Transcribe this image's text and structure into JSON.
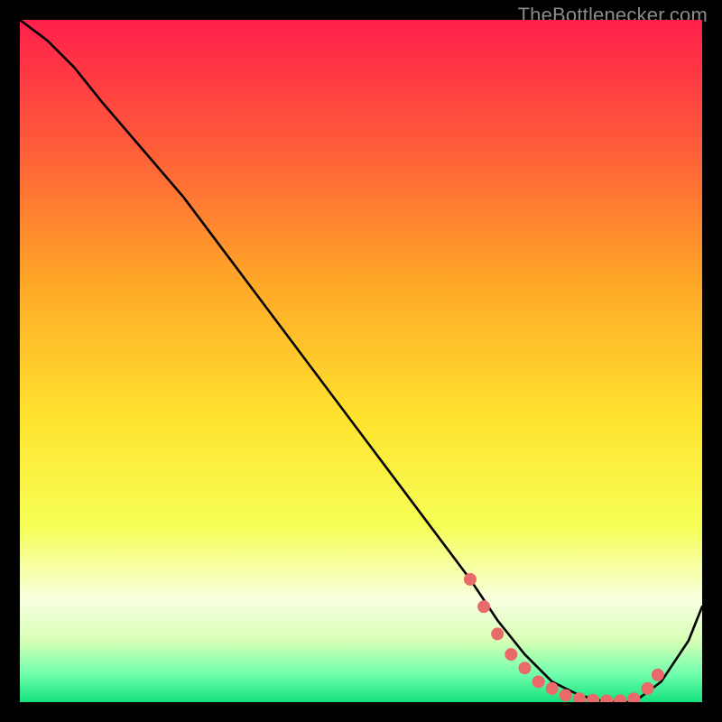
{
  "attribution": "TheBottlenecker.com",
  "colors": {
    "page_bg": "#000000",
    "gradient_top": "#ff1f4b",
    "gradient_upper": "#ff5a3a",
    "gradient_mid_high": "#ffa628",
    "gradient_mid": "#ffe22e",
    "gradient_mid_low": "#f6ff55",
    "gradient_low1": "#d6ffb5",
    "gradient_low2": "#6effad",
    "gradient_band_light": "#f8ffe0",
    "gradient_bottom": "#14e07c",
    "curve": "#000000",
    "marker_fill": "#e96a68",
    "marker_stroke": "#e96a68"
  },
  "chart_data": {
    "type": "line",
    "title": "",
    "xlabel": "",
    "ylabel": "",
    "xlim": [
      0,
      100
    ],
    "ylim": [
      0,
      100
    ],
    "series": [
      {
        "name": "bottleneck-curve",
        "x": [
          0,
          4,
          8,
          12,
          18,
          24,
          30,
          36,
          42,
          48,
          54,
          60,
          66,
          70,
          74,
          78,
          82,
          86,
          90,
          94,
          98,
          100
        ],
        "y": [
          100,
          97,
          93,
          88,
          81,
          74,
          66,
          58,
          50,
          42,
          34,
          26,
          18,
          12,
          7,
          3,
          1,
          0,
          0,
          3,
          9,
          14
        ]
      }
    ],
    "markers": {
      "name": "highlight-region",
      "x": [
        66,
        68,
        70,
        72,
        74,
        76,
        78,
        80,
        82,
        84,
        86,
        88,
        90,
        92,
        93.5
      ],
      "y": [
        18,
        14,
        10,
        7,
        5,
        3,
        2,
        1,
        0.5,
        0.3,
        0.2,
        0.2,
        0.5,
        2,
        4
      ]
    }
  }
}
